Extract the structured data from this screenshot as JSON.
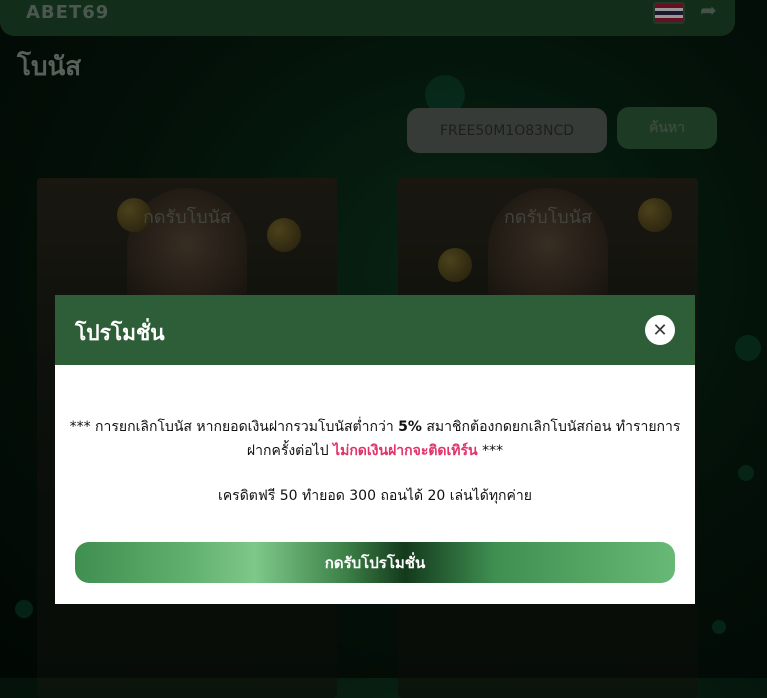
{
  "header": {
    "logo_text": "ABET69",
    "flag_icon": "thai-flag-icon",
    "logout_icon": "logout-icon"
  },
  "page": {
    "title": "โบนัส"
  },
  "search": {
    "code_value": "FREE50M1O83NCD",
    "button_label": "ค้นหา"
  },
  "cards": [
    {
      "claim_label": "กดรับโบนัส"
    },
    {
      "claim_label": "กดรับโบนัส"
    }
  ],
  "modal": {
    "title": "โปรโมชั่น",
    "close_icon": "close-icon",
    "notice_prefix": "*** การยกเลิกโบนัส หากยอดเงินฝากรวมโบนัสต่ำกว่า ",
    "notice_percent": "5%",
    "notice_mid": " สมาชิกต้องกดยกเลิกโบนัสก่อน ทำรายการฝากครั้งต่อไป ",
    "notice_warning": "ไม่กดเงินฝากจะติดเทิร์น",
    "notice_suffix": " ***",
    "credit_line": "เครดิตฟรี 50 ทำยอด 300 ถอนได้ 20 เล่นได้ทุกค่าย",
    "claim_button_label": "กดรับโปรโมชั่น"
  },
  "colors": {
    "header_green": "#2d5e38",
    "warning_pink": "#e2336b",
    "button_green": "#5fae6c"
  }
}
